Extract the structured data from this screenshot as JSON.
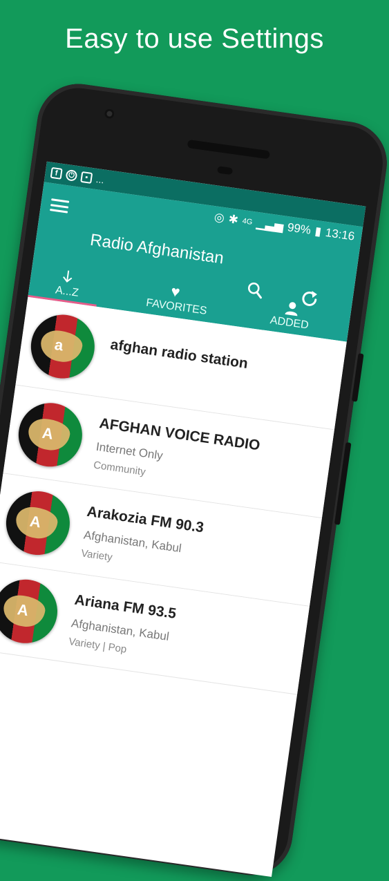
{
  "promo": {
    "title": "Easy to use Settings"
  },
  "status_bar": {
    "notification_more": "...",
    "network": "4G",
    "battery": "99%",
    "time": "13:16"
  },
  "app_bar": {
    "title": "Radio Afghanistan"
  },
  "tabs": [
    {
      "label": "A...Z",
      "icon": "arrow-down-icon",
      "selected": true
    },
    {
      "label": "FAVORITES",
      "icon": "heart-icon",
      "selected": false
    },
    {
      "label": "ADDED",
      "icon": "person-icon",
      "selected": false
    }
  ],
  "stations": [
    {
      "name": "afghan radio station",
      "sub": "",
      "genre": "",
      "logo_letter": "a"
    },
    {
      "name": "AFGHAN VOICE RADIO",
      "sub": "Internet Only",
      "genre": "Community",
      "logo_letter": "A"
    },
    {
      "name": "Arakozia FM 90.3",
      "sub": "Afghanistan, Kabul",
      "genre": "Variety",
      "logo_letter": "A"
    },
    {
      "name": "Ariana FM 93.5",
      "sub": "Afghanistan, Kabul",
      "genre": "Variety | Pop",
      "logo_letter": "A"
    }
  ],
  "colors": {
    "background": "#129a5a",
    "app_bar": "#1aa091",
    "tab_indicator": "#e75c8a"
  }
}
